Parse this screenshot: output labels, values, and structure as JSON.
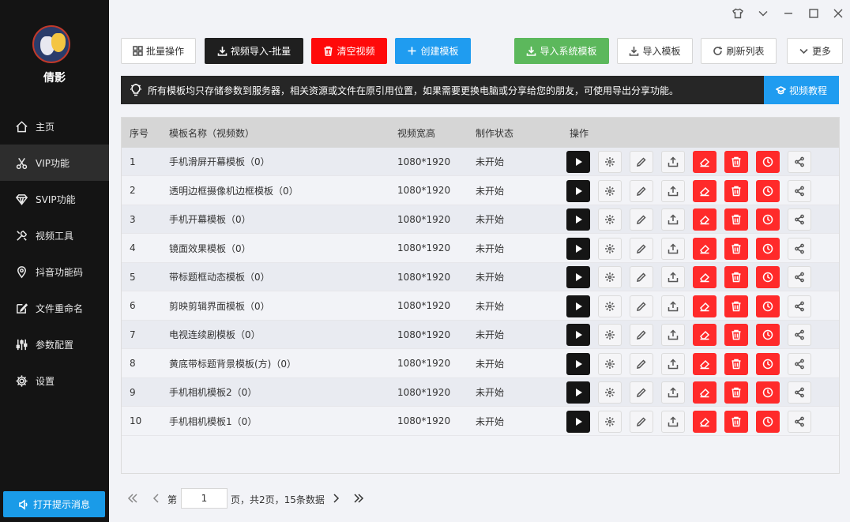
{
  "app": {
    "name": "倩影"
  },
  "sidebar": {
    "items": [
      {
        "label": "主页",
        "icon": "home-icon"
      },
      {
        "label": "VIP功能",
        "icon": "scissors-icon",
        "active": true
      },
      {
        "label": "SVIP功能",
        "icon": "diamond-icon"
      },
      {
        "label": "视频工具",
        "icon": "tools-icon"
      },
      {
        "label": "抖音功能码",
        "icon": "location-pin-icon"
      },
      {
        "label": "文件重命名",
        "icon": "edit-file-icon"
      },
      {
        "label": "参数配置",
        "icon": "sliders-icon"
      },
      {
        "label": "设置",
        "icon": "gear-icon"
      }
    ],
    "notify_label": "打开提示消息"
  },
  "toolbar": {
    "batch": "批量操作",
    "import_batch": "视频导入-批量",
    "clear": "清空视频",
    "create": "创建模板",
    "import_system": "导入系统模板",
    "import_template": "导入模板",
    "refresh": "刷新列表",
    "more": "更多"
  },
  "notice": {
    "text": "所有模板均只存储参数到服务器，相关资源或文件在原引用位置，如果需要更换电脑或分享给您的朋友，可使用导出分享功能。",
    "tutorial": "视频教程"
  },
  "table": {
    "headers": {
      "no": "序号",
      "name": "模板名称（视频数）",
      "size": "视频宽高",
      "status": "制作状态",
      "ops": "操作"
    },
    "rows": [
      {
        "no": "1",
        "name": "手机滑屏开幕模板（0）",
        "size": "1080*1920",
        "status": "未开始"
      },
      {
        "no": "2",
        "name": "透明边框摄像机边框模板（0）",
        "size": "1080*1920",
        "status": "未开始"
      },
      {
        "no": "3",
        "name": "手机开幕模板（0）",
        "size": "1080*1920",
        "status": "未开始"
      },
      {
        "no": "4",
        "name": "镜面效果模板（0）",
        "size": "1080*1920",
        "status": "未开始"
      },
      {
        "no": "5",
        "name": "带标题框动态模板（0）",
        "size": "1080*1920",
        "status": "未开始"
      },
      {
        "no": "6",
        "name": "剪映剪辑界面模板（0）",
        "size": "1080*1920",
        "status": "未开始"
      },
      {
        "no": "7",
        "name": "电视连续剧模板（0）",
        "size": "1080*1920",
        "status": "未开始"
      },
      {
        "no": "8",
        "name": "黄底带标题背景模板(方)（0）",
        "size": "1080*1920",
        "status": "未开始"
      },
      {
        "no": "9",
        "name": "手机相机模板2（0）",
        "size": "1080*1920",
        "status": "未开始"
      },
      {
        "no": "10",
        "name": "手机相机模板1（0）",
        "size": "1080*1920",
        "status": "未开始"
      }
    ]
  },
  "pager": {
    "prefix": "第",
    "page": "1",
    "suffix": "页，共2页，15条数据"
  },
  "colors": {
    "accent": "#1f9cf0",
    "danger": "#ff0a0a",
    "success": "#5cb85c",
    "dark": "#1f1f1f"
  }
}
